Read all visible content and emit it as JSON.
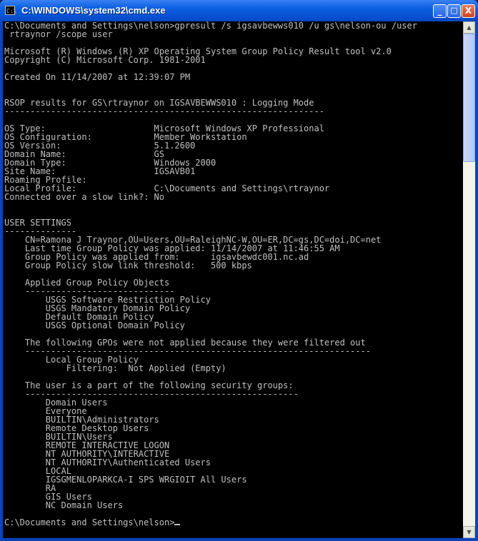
{
  "window": {
    "title": "C:\\WINDOWS\\system32\\cmd.exe",
    "icon_label": "C:\\",
    "minimize_glyph": "_",
    "maximize_glyph": "□",
    "close_glyph": "X"
  },
  "console": {
    "lines": [
      "C:\\Documents and Settings\\nelson>gpresult /s igsavbewws010 /u gs\\nelson-ou /user",
      " rtraynor /scope user",
      "",
      "Microsoft (R) Windows (R) XP Operating System Group Policy Result tool v2.0",
      "Copyright (C) Microsoft Corp. 1981-2001",
      "",
      "Created On 11/14/2007 at 12:39:07 PM",
      "",
      "",
      "RSOP results for GS\\rtraynor on IGSAVBEWWS010 : Logging Mode",
      "--------------------------------------------------------------",
      "",
      "OS Type:                     Microsoft Windows XP Professional",
      "OS Configuration:            Member Workstation",
      "OS Version:                  5.1.2600",
      "Domain Name:                 GS",
      "Domain Type:                 Windows 2000",
      "Site Name:                   IGSAVB01",
      "Roaming Profile:",
      "Local Profile:               C:\\Documents and Settings\\rtraynor",
      "Connected over a slow link?: No",
      "",
      "",
      "USER SETTINGS",
      "--------------",
      "    CN=Ramona J Traynor,OU=Users,OU=RaleighNC-W,OU=ER,DC=gs,DC=doi,DC=net",
      "    Last time Group Policy was applied: 11/14/2007 at 11:46:55 AM",
      "    Group Policy was applied from:      igsavbewdc001.nc.ad",
      "    Group Policy slow link threshold:   500 kbps",
      "",
      "    Applied Group Policy Objects",
      "    -----------------------------",
      "        USGS Software Restriction Policy",
      "        USGS Mandatory Domain Policy",
      "        Default Domain Policy",
      "        USGS Optional Domain Policy",
      "",
      "    The following GPOs were not applied because they were filtered out",
      "    -------------------------------------------------------------------",
      "        Local Group Policy",
      "            Filtering:  Not Applied (Empty)",
      "",
      "    The user is a part of the following security groups:",
      "    -----------------------------------------------------",
      "        Domain Users",
      "        Everyone",
      "        BUILTIN\\Administrators",
      "        Remote Desktop Users",
      "        BUILTIN\\Users",
      "        REMOTE INTERACTIVE LOGON",
      "        NT AUTHORITY\\INTERACTIVE",
      "        NT AUTHORITY\\Authenticated Users",
      "        LOCAL",
      "        IGSGMENLOPARKCA-I SPS WRGIOIT All Users",
      "        RA",
      "        GIS Users",
      "        NC Domain Users",
      "",
      "C:\\Documents and Settings\\nelson>"
    ]
  },
  "scrollbar": {
    "up_glyph": "▲",
    "down_glyph": "▼"
  }
}
